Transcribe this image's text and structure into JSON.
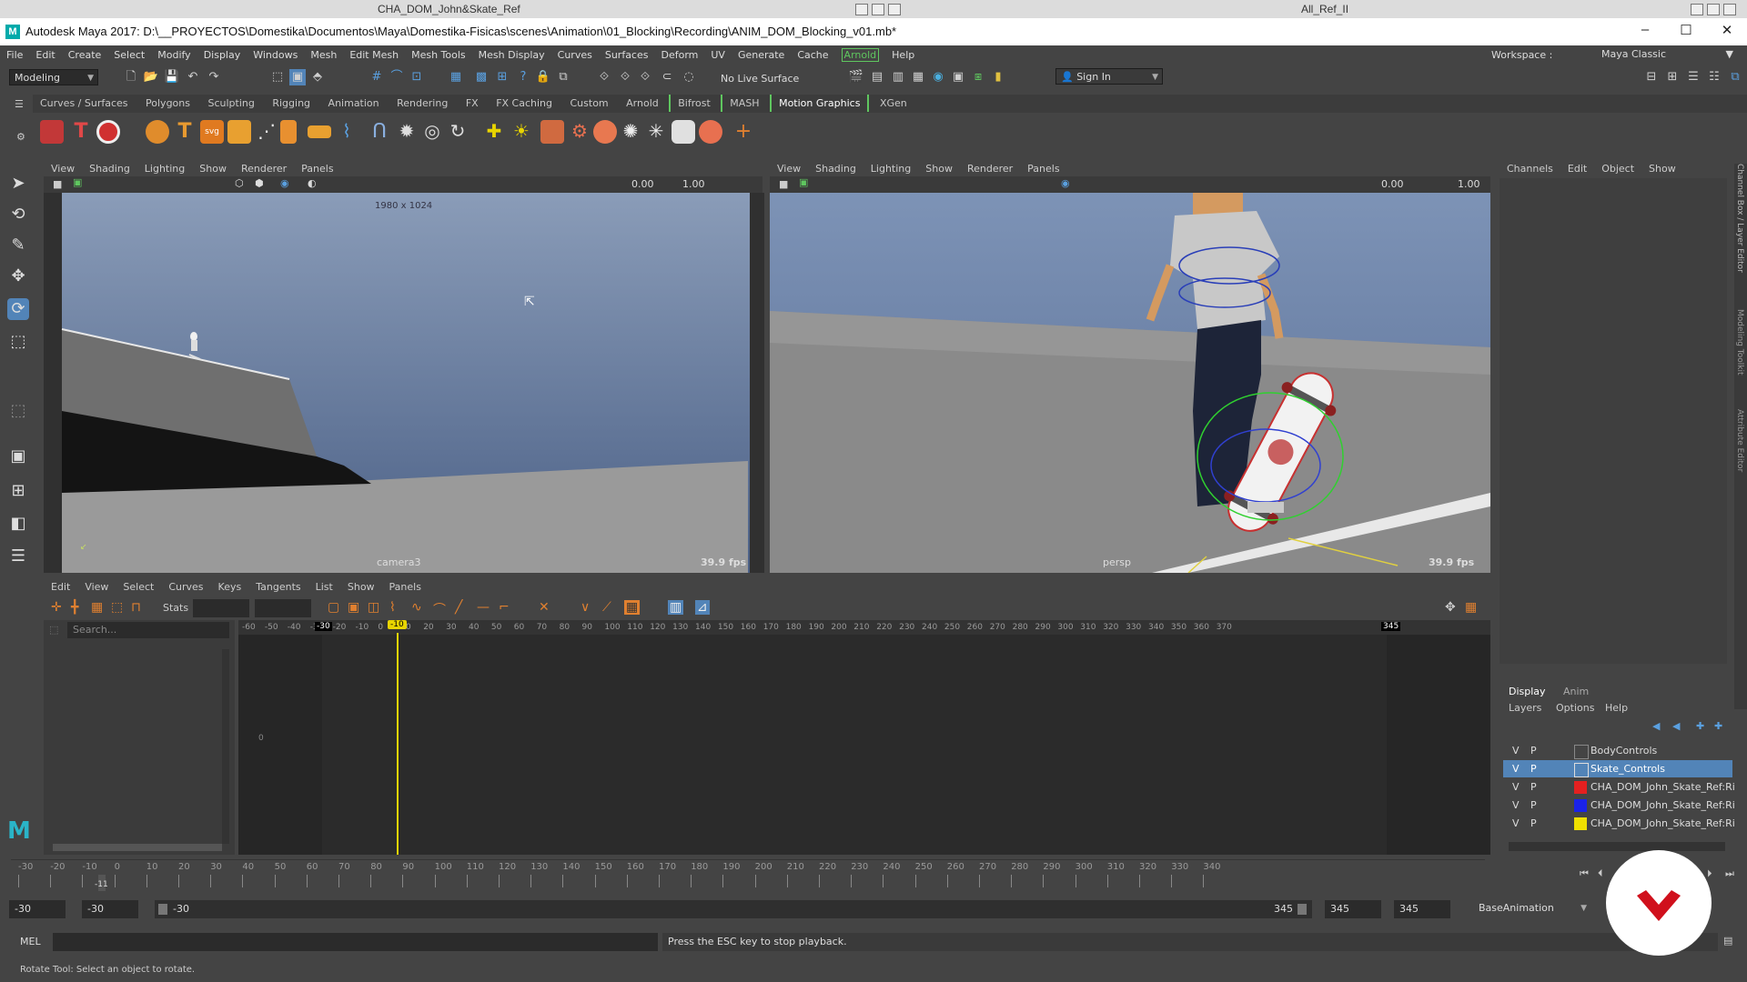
{
  "ghost": {
    "left_title": "CHA_DOM_John&Skate_Ref",
    "right_title": "All_Ref_II"
  },
  "window": {
    "title": "Autodesk Maya 2017: D:\\__PROYECTOS\\Domestika\\Documentos\\Maya\\Domestika-Fisicas\\scenes\\Animation\\01_Blocking\\Recording\\ANIM_DOM_Blocking_v01.mb*",
    "minimize": "–",
    "maximize": "☐",
    "close": "✕"
  },
  "menubar": {
    "items": [
      "File",
      "Edit",
      "Create",
      "Select",
      "Modify",
      "Display",
      "Windows",
      "Mesh",
      "Edit Mesh",
      "Mesh Tools",
      "Mesh Display",
      "Curves",
      "Surfaces",
      "Deform",
      "UV",
      "Generate",
      "Cache",
      "Arnold",
      "Help"
    ],
    "workspace_label": "Workspace :",
    "workspace_value": "Maya Classic"
  },
  "statusline": {
    "mode": "Modeling",
    "live_surface": "No Live Surface",
    "sign_in": "Sign In"
  },
  "shelf": {
    "tabs": [
      "Curves / Surfaces",
      "Polygons",
      "Sculpting",
      "Rigging",
      "Animation",
      "Rendering",
      "FX",
      "FX Caching",
      "Custom",
      "Arnold",
      "Bifrost",
      "MASH",
      "Motion Graphics",
      "XGen"
    ],
    "active_tab": "Motion Graphics"
  },
  "panel_left": {
    "menu": [
      "View",
      "Shading",
      "Lighting",
      "Show",
      "Renderer",
      "Panels"
    ],
    "val1": "0.00",
    "val2": "1.00",
    "resolution": "1980 x 1024",
    "camera": "camera3",
    "fps": "39.9 fps"
  },
  "panel_right": {
    "menu": [
      "View",
      "Shading",
      "Lighting",
      "Show",
      "Renderer",
      "Panels"
    ],
    "val1": "0.00",
    "val2": "1.00",
    "camera": "persp",
    "fps": "39.9 fps"
  },
  "graph_editor": {
    "menu": [
      "Edit",
      "View",
      "Select",
      "Curves",
      "Keys",
      "Tangents",
      "List",
      "Show",
      "Panels"
    ],
    "stats_label": "Stats",
    "search_placeholder": "Search...",
    "ticks": [
      "-60",
      "-50",
      "-40",
      "-30",
      "-20",
      "-10",
      "0",
      "10",
      "20",
      "30",
      "40",
      "50",
      "60",
      "70",
      "80",
      "90",
      "100",
      "110",
      "120",
      "130",
      "140",
      "150",
      "160",
      "170",
      "180",
      "190",
      "200",
      "210",
      "220",
      "230",
      "240",
      "250",
      "260",
      "270",
      "280",
      "290",
      "300",
      "310",
      "320",
      "330",
      "340",
      "350",
      "360",
      "370"
    ],
    "range_start": "-30",
    "range_end": "345",
    "current": "-10",
    "y_zero": "0"
  },
  "channel_box": {
    "menu": [
      "Channels",
      "Edit",
      "Object",
      "Show"
    ],
    "side_tabs": [
      "Channel Box / Layer Editor",
      "Modeling Toolkit",
      "Attribute Editor"
    ],
    "layer_tabs": [
      "Display",
      "Anim"
    ],
    "layer_menu": [
      "Layers",
      "Options",
      "Help"
    ],
    "layers": [
      {
        "v": "V",
        "p": "P",
        "name": "BodyControls",
        "color": "",
        "selected": false
      },
      {
        "v": "V",
        "p": "P",
        "name": "Skate_Controls",
        "color": "",
        "selected": true
      },
      {
        "v": "V",
        "p": "P",
        "name": "CHA_DOM_John_Skate_Ref:Ri",
        "color": "#e52020",
        "selected": false
      },
      {
        "v": "V",
        "p": "P",
        "name": "CHA_DOM_John_Skate_Ref:Ri",
        "color": "#1a22e8",
        "selected": false
      },
      {
        "v": "V",
        "p": "P",
        "name": "CHA_DOM_John_Skate_Ref:Ri",
        "color": "#f0e000",
        "selected": false
      }
    ]
  },
  "timeslider": {
    "ticks": [
      "-30",
      "-20",
      "-10",
      "0",
      "10",
      "20",
      "30",
      "40",
      "50",
      "60",
      "70",
      "80",
      "90",
      "100",
      "110",
      "120",
      "130",
      "140",
      "150",
      "160",
      "170",
      "180",
      "190",
      "200",
      "210",
      "220",
      "230",
      "240",
      "250",
      "260",
      "270",
      "280",
      "290",
      "300",
      "310",
      "320",
      "330",
      "340"
    ],
    "current": "-11"
  },
  "rangebar": {
    "start": "-30",
    "playback_start": "-30",
    "slider_start": "-30",
    "slider_end": "345",
    "playback_end": "345",
    "end": "345",
    "anim_layer": "BaseAnimation"
  },
  "cmdline": {
    "label": "MEL",
    "result": "Press the ESC key to stop playback."
  },
  "helpline": {
    "text": "Rotate Tool: Select an object to rotate."
  },
  "colors": {
    "accent_yellow": "#e8d400",
    "selection_blue": "#5284b8",
    "arnold_green": "#5fc65f",
    "domestika_red": "#d0101c"
  }
}
